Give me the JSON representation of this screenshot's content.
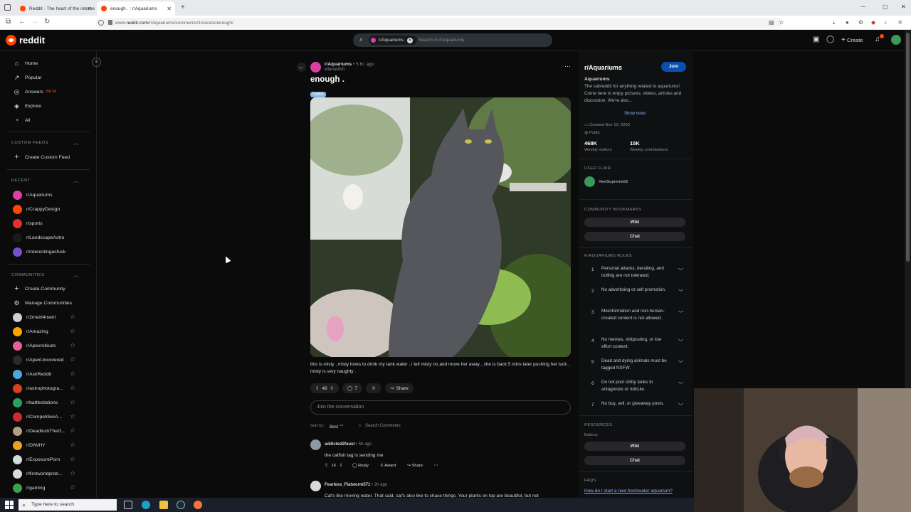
{
  "browser": {
    "tabs": [
      {
        "title": "Reddit - The heart of the interne"
      },
      {
        "title": "enough . : r/Aquariums"
      }
    ],
    "url_prefix": "www.",
    "url_host": "reddit.com",
    "url_path": "/r/Aquariums/comments/1novazx/enough/"
  },
  "header": {
    "logo": "reddit",
    "search_chip": "r/Aquariums",
    "search_placeholder": "Search in r/Aquariums",
    "create_label": "Create"
  },
  "sidebar": {
    "main": [
      {
        "label": "Home",
        "icon": "home-icon"
      },
      {
        "label": "Popular",
        "icon": "popular-icon"
      },
      {
        "label": "Answers",
        "badge": "BETA",
        "icon": "answers-icon"
      },
      {
        "label": "Explore",
        "icon": "explore-icon"
      },
      {
        "label": "All",
        "icon": "all-icon"
      }
    ],
    "custom_feeds_title": "CUSTOM FEEDS",
    "create_custom_feed": "Create Custom Feed",
    "recent_title": "RECENT",
    "recent": [
      {
        "label": "r/Aquariums",
        "color": "#d93fa4"
      },
      {
        "label": "r/CrappyDesign",
        "color": "#ff4500"
      },
      {
        "label": "r/sports",
        "color": "#e03030"
      },
      {
        "label": "r/LandscapeAstro",
        "color": "#1a1a1b"
      },
      {
        "label": "r/interestingasfuck",
        "color": "#7a4ec7"
      }
    ],
    "communities_title": "COMMUNITIES",
    "create_community": "Create Community",
    "manage_communities": "Manage Communities",
    "communities": [
      {
        "label": "r/2meirl4meirl",
        "color": "#cfcfcf"
      },
      {
        "label": "r/Amazing",
        "color": "#f7a600"
      },
      {
        "label": "r/Apexrollouts",
        "color": "#e85d9c"
      },
      {
        "label": "r/ApexUncovered",
        "color": "#2a2a2a"
      },
      {
        "label": "r/AskReddit",
        "color": "#4aa8e0"
      },
      {
        "label": "r/astrophotogra...",
        "color": "#d64020"
      },
      {
        "label": "r/battlestations",
        "color": "#2aa060"
      },
      {
        "label": "r/CompetitiveA...",
        "color": "#d02a2a"
      },
      {
        "label": "r/DeadlockTheG...",
        "color": "#b0a080"
      },
      {
        "label": "r/DIWHY",
        "color": "#f0a020"
      },
      {
        "label": "r/ExposurePorn",
        "color": "#d7dadc"
      },
      {
        "label": "r/firstworldprob...",
        "color": "#d7dadc"
      },
      {
        "label": "r/gaming",
        "color": "#3aa050"
      }
    ]
  },
  "post": {
    "subreddit": "r/Aquariums",
    "time": "5 hr. ago",
    "author": "ellanasfish",
    "title": "enough .",
    "flair": "Catfish",
    "body": "this is misty , misty loves to drink my tank water , i tell misty no and move her away , she is back 5 mins later pushing her luck , misty is very naughty .",
    "votes": "48",
    "comments": "7",
    "share": "Share",
    "join_placeholder": "Join the conversation",
    "sort_label": "Sort by:",
    "sort_value": "Best",
    "search_comments": "Search Comments"
  },
  "comments": [
    {
      "author": "addicted2faust",
      "time": "5h ago",
      "text": "the catfish tag is sending me",
      "votes": "16",
      "reply": "Reply",
      "award": "Award",
      "share": "Share"
    },
    {
      "author": "Fearless_Flatworm571",
      "time": "2h ago",
      "text": "Cat's like moving water. That said, cat's also like to chase things. Your plants on top are beautiful, but not"
    }
  ],
  "community": {
    "name": "r/Aquariums",
    "join": "Join",
    "title": "Aquariums",
    "description": "The subreddit for anything related to aquariums! Come here to enjoy pictures, videos, articles and discussion. We're also...",
    "show_more": "Show more",
    "created": "Created Nov 10, 2009",
    "visibility": "Public",
    "visitors": "468K",
    "visitors_label": "Weekly visitors",
    "contributions": "15K",
    "contributions_label": "Weekly contributions",
    "user_flair_title": "USER FLAIR",
    "user_flair_name": "YeetSupreme92",
    "bookmarks_title": "COMMUNITY BOOKMARKS",
    "bookmark1": "Wiki",
    "bookmark2": "Chat",
    "rules_title": "R/AQUARIUMS RULES",
    "rules": [
      {
        "num": "1",
        "text": "Personal attacks, derailing, and trolling are not tolerated."
      },
      {
        "num": "2",
        "text": "No advertising or self promotion."
      },
      {
        "num": "3",
        "text": "Misinformation and non-human-created content is not allowed."
      },
      {
        "num": "4",
        "text": "No memes, shitposting, or low effort content."
      },
      {
        "num": "5",
        "text": "Dead and dying animals must be tagged NSFW."
      },
      {
        "num": "6",
        "text": "Do not post shitty tanks to antagonize or ridicule."
      },
      {
        "num": "7",
        "text": "No buy, sell, or giveaway posts."
      }
    ],
    "resources_title": "RESOURCES",
    "buttons_label": "Buttons",
    "res1": "Wiki",
    "res2": "Chat",
    "faqs_title": "FAQS",
    "faq_link": "How do I start a new freshwater aquarium?"
  },
  "taskbar": {
    "search_placeholder": "Type here to search"
  }
}
